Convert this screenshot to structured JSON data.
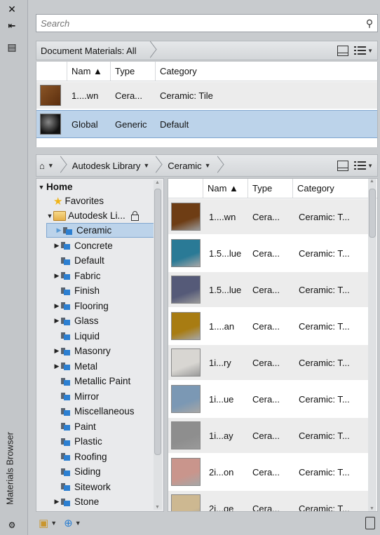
{
  "panel": {
    "title": "Materials Browser",
    "close_glyph": "✕",
    "autohide_glyph": "⇤",
    "properties_glyph": "▤"
  },
  "search": {
    "placeholder": "Search",
    "value": "",
    "icon": "magnifier-icon"
  },
  "document_materials": {
    "breadcrumb": "Document Materials: All",
    "columns": [
      "",
      "Nam ▲",
      "Type",
      "Category"
    ],
    "rows": [
      {
        "name": "1....wn",
        "type": "Cera...",
        "category": "Ceramic: Tile",
        "swatch": "#6b3a16"
      },
      {
        "name": "Global",
        "type": "Generic",
        "category": "Default",
        "swatch": "#2a2a2a",
        "selected": true
      }
    ]
  },
  "library_bar": {
    "home_glyph": "⌂",
    "crumbs": [
      "Autodesk Library",
      "Ceramic"
    ]
  },
  "tree": {
    "home": "Home",
    "favorites": "Favorites",
    "library": "Autodesk Li...",
    "items": [
      {
        "label": "Ceramic",
        "expandable": true,
        "selected": true
      },
      {
        "label": "Concrete",
        "expandable": true
      },
      {
        "label": "Default",
        "expandable": false
      },
      {
        "label": "Fabric",
        "expandable": true
      },
      {
        "label": "Finish",
        "expandable": false
      },
      {
        "label": "Flooring",
        "expandable": true
      },
      {
        "label": "Glass",
        "expandable": true
      },
      {
        "label": "Liquid",
        "expandable": false
      },
      {
        "label": "Masonry",
        "expandable": true
      },
      {
        "label": "Metal",
        "expandable": true
      },
      {
        "label": "Metallic Paint",
        "expandable": false
      },
      {
        "label": "Mirror",
        "expandable": false
      },
      {
        "label": "Miscellaneous",
        "expandable": false
      },
      {
        "label": "Paint",
        "expandable": false
      },
      {
        "label": "Plastic",
        "expandable": false
      },
      {
        "label": "Roofing",
        "expandable": false
      },
      {
        "label": "Siding",
        "expandable": false
      },
      {
        "label": "Sitework",
        "expandable": false
      },
      {
        "label": "Stone",
        "expandable": true
      }
    ]
  },
  "library_table": {
    "columns": [
      "",
      "Nam ▲",
      "Type",
      "Category"
    ],
    "rows": [
      {
        "name": "1....wn",
        "type": "Cera...",
        "category": "Ceramic: T...",
        "swatch": "#6e3d14"
      },
      {
        "name": "1.5...lue",
        "type": "Cera...",
        "category": "Ceramic: T...",
        "swatch": "#2a7a96"
      },
      {
        "name": "1.5...lue",
        "type": "Cera...",
        "category": "Ceramic: T...",
        "swatch": "#555a78"
      },
      {
        "name": "1....an",
        "type": "Cera...",
        "category": "Ceramic: T...",
        "swatch": "#a87c12"
      },
      {
        "name": "1i...ry",
        "type": "Cera...",
        "category": "Ceramic: T...",
        "swatch": "#d8d6d2"
      },
      {
        "name": "1i...ue",
        "type": "Cera...",
        "category": "Ceramic: T...",
        "swatch": "#7b98b4"
      },
      {
        "name": "1i...ay",
        "type": "Cera...",
        "category": "Ceramic: T...",
        "swatch": "#8e8e8e"
      },
      {
        "name": "2i...on",
        "type": "Cera...",
        "category": "Ceramic: T...",
        "swatch": "#c9958c"
      },
      {
        "name": "2i...ge",
        "type": "Cera...",
        "category": "Ceramic: T...",
        "swatch": "#cdb891"
      }
    ]
  }
}
